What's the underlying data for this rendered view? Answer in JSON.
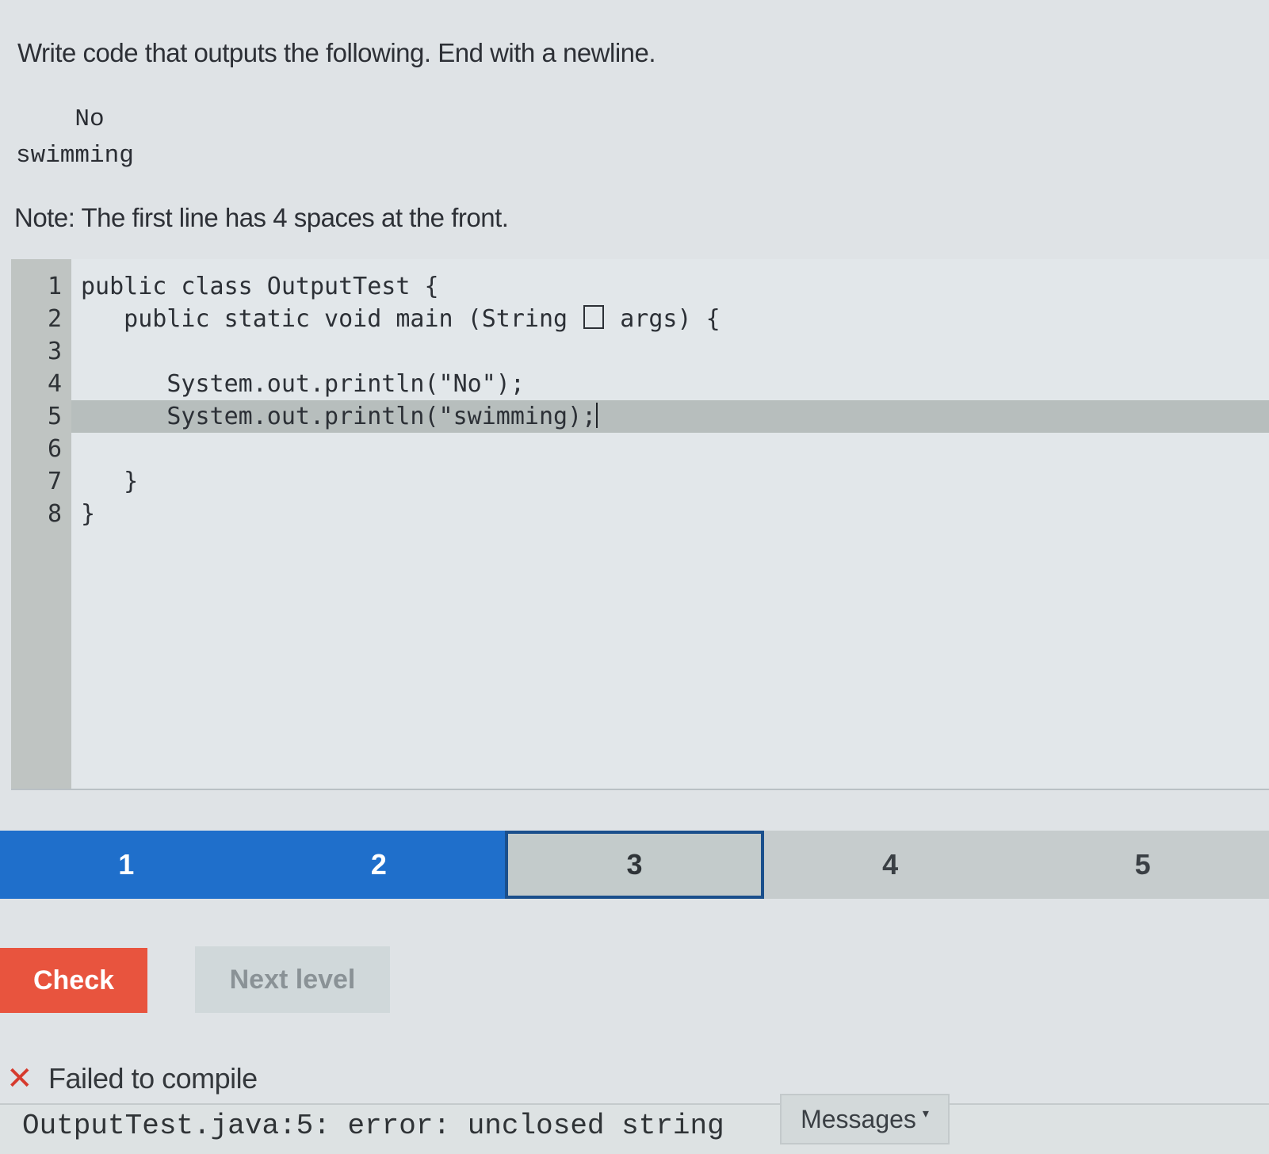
{
  "prompt": "Write code that outputs the following. End with a newline.",
  "expected_output": "    No\nswimming",
  "note": "Note: The first line has 4 spaces at the front.",
  "editor": {
    "line_numbers": [
      "1",
      "2",
      "3",
      "4",
      "5",
      "6",
      "7",
      "8"
    ],
    "lines": {
      "l1": "public class OutputTest {",
      "l2a": "   public static void main (String",
      "l2b": "args) {",
      "l3": "",
      "l4": "      System.out.println(\"No\");",
      "l5": "      System.out.println(\"swimming);",
      "l6": "",
      "l7": "   }",
      "l8": "}"
    },
    "active_line": 5
  },
  "levels": {
    "items": [
      "1",
      "2",
      "3",
      "4",
      "5"
    ],
    "current": 3
  },
  "buttons": {
    "check": "Check",
    "next_level": "Next level"
  },
  "result": {
    "status": "Failed to compile",
    "console": "OutputTest.java:5: error: unclosed string",
    "messages_button": "Messages",
    "status_color": "#d63b2e"
  }
}
